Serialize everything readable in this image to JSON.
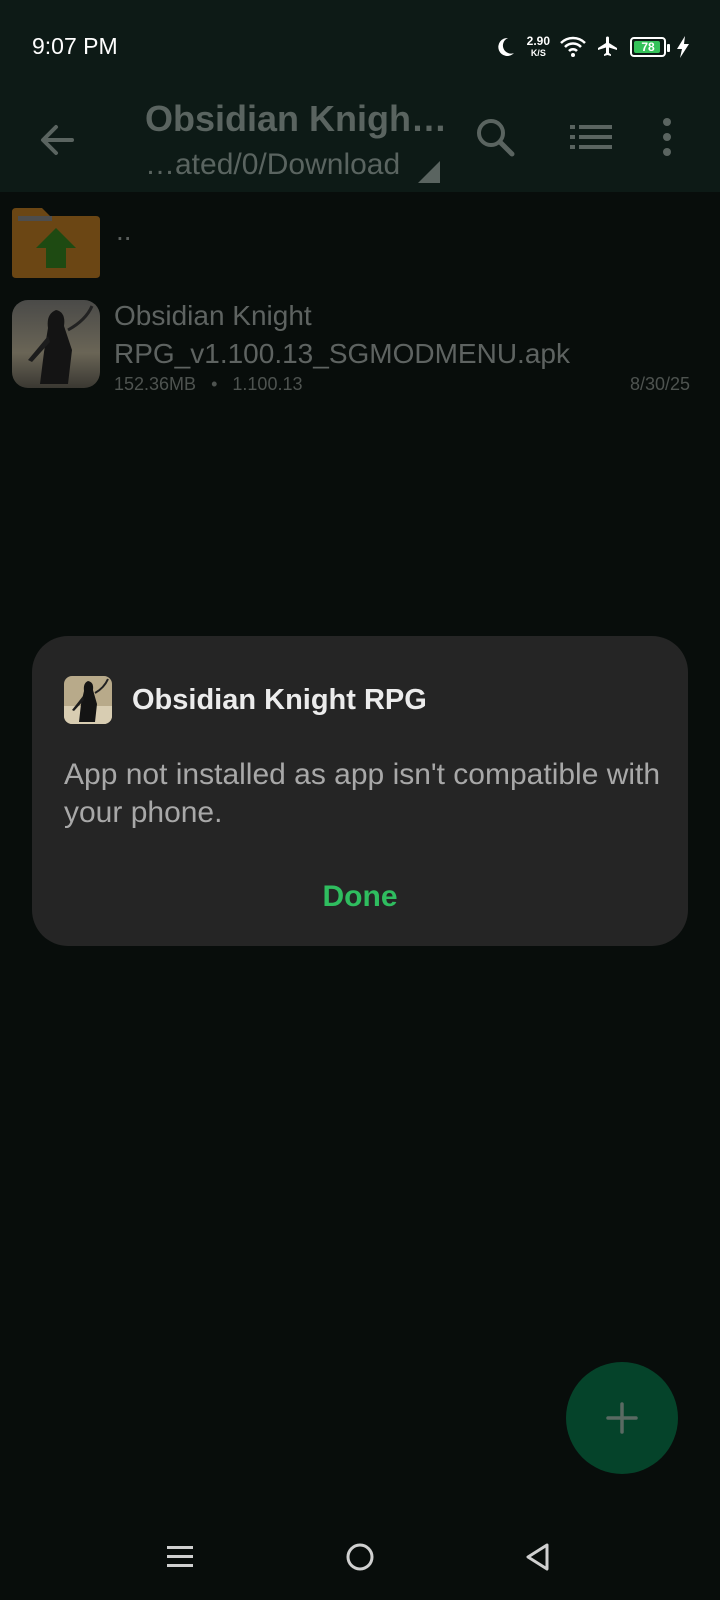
{
  "status_bar": {
    "time": "9:07 PM",
    "net_speed_value": "2.90",
    "net_speed_unit": "K/S",
    "battery_level": "78",
    "icons": [
      "moon-icon",
      "wifi-icon",
      "airplane-icon",
      "battery-icon",
      "charging-icon"
    ]
  },
  "toolbar": {
    "title": "Obsidian Knigh…",
    "path": "…ated/0/Download",
    "icons": [
      "back-arrow-icon",
      "search-icon",
      "list-view-icon",
      "more-vert-icon"
    ]
  },
  "file_list": {
    "parent_folder_label": "..",
    "items": [
      {
        "name": "Obsidian Knight RPG_v1.100.13_SGMODMENU.apk",
        "size": "152.36MB",
        "separator": "•",
        "version": "1.100.13",
        "date": "8/30/25"
      }
    ]
  },
  "dialog": {
    "title": "Obsidian Knight RPG",
    "message": "App not installed as app isn't compatible with your phone.",
    "button_label": "Done"
  },
  "fab": {
    "icon": "plus-icon"
  },
  "colors": {
    "accent": "#2fbd5f",
    "fab_bg": "#05432a",
    "toolbar_bg": "#0d1a16",
    "background": "#080d0b",
    "dialog_bg": "#252525",
    "battery_fill": "#35c25a"
  }
}
